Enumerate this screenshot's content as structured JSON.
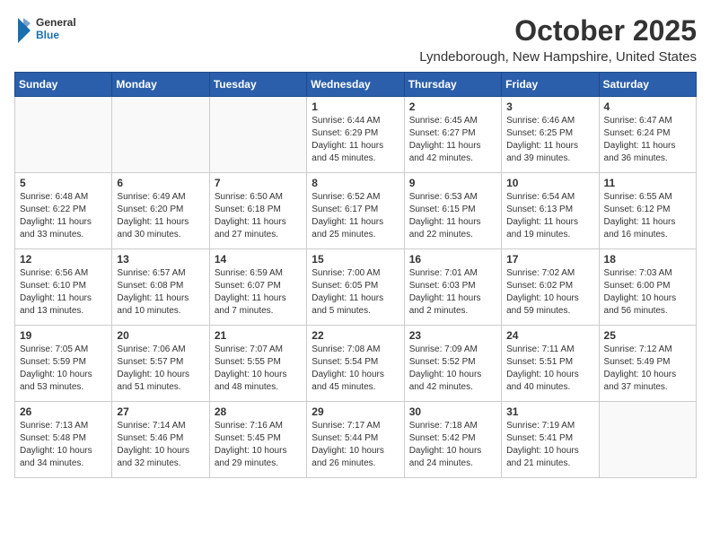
{
  "logo": {
    "general": "General",
    "blue": "Blue"
  },
  "header": {
    "month": "October 2025",
    "location": "Lyndeborough, New Hampshire, United States"
  },
  "weekdays": [
    "Sunday",
    "Monday",
    "Tuesday",
    "Wednesday",
    "Thursday",
    "Friday",
    "Saturday"
  ],
  "weeks": [
    [
      {
        "day": "",
        "info": ""
      },
      {
        "day": "",
        "info": ""
      },
      {
        "day": "",
        "info": ""
      },
      {
        "day": "1",
        "info": "Sunrise: 6:44 AM\nSunset: 6:29 PM\nDaylight: 11 hours\nand 45 minutes."
      },
      {
        "day": "2",
        "info": "Sunrise: 6:45 AM\nSunset: 6:27 PM\nDaylight: 11 hours\nand 42 minutes."
      },
      {
        "day": "3",
        "info": "Sunrise: 6:46 AM\nSunset: 6:25 PM\nDaylight: 11 hours\nand 39 minutes."
      },
      {
        "day": "4",
        "info": "Sunrise: 6:47 AM\nSunset: 6:24 PM\nDaylight: 11 hours\nand 36 minutes."
      }
    ],
    [
      {
        "day": "5",
        "info": "Sunrise: 6:48 AM\nSunset: 6:22 PM\nDaylight: 11 hours\nand 33 minutes."
      },
      {
        "day": "6",
        "info": "Sunrise: 6:49 AM\nSunset: 6:20 PM\nDaylight: 11 hours\nand 30 minutes."
      },
      {
        "day": "7",
        "info": "Sunrise: 6:50 AM\nSunset: 6:18 PM\nDaylight: 11 hours\nand 27 minutes."
      },
      {
        "day": "8",
        "info": "Sunrise: 6:52 AM\nSunset: 6:17 PM\nDaylight: 11 hours\nand 25 minutes."
      },
      {
        "day": "9",
        "info": "Sunrise: 6:53 AM\nSunset: 6:15 PM\nDaylight: 11 hours\nand 22 minutes."
      },
      {
        "day": "10",
        "info": "Sunrise: 6:54 AM\nSunset: 6:13 PM\nDaylight: 11 hours\nand 19 minutes."
      },
      {
        "day": "11",
        "info": "Sunrise: 6:55 AM\nSunset: 6:12 PM\nDaylight: 11 hours\nand 16 minutes."
      }
    ],
    [
      {
        "day": "12",
        "info": "Sunrise: 6:56 AM\nSunset: 6:10 PM\nDaylight: 11 hours\nand 13 minutes."
      },
      {
        "day": "13",
        "info": "Sunrise: 6:57 AM\nSunset: 6:08 PM\nDaylight: 11 hours\nand 10 minutes."
      },
      {
        "day": "14",
        "info": "Sunrise: 6:59 AM\nSunset: 6:07 PM\nDaylight: 11 hours\nand 7 minutes."
      },
      {
        "day": "15",
        "info": "Sunrise: 7:00 AM\nSunset: 6:05 PM\nDaylight: 11 hours\nand 5 minutes."
      },
      {
        "day": "16",
        "info": "Sunrise: 7:01 AM\nSunset: 6:03 PM\nDaylight: 11 hours\nand 2 minutes."
      },
      {
        "day": "17",
        "info": "Sunrise: 7:02 AM\nSunset: 6:02 PM\nDaylight: 10 hours\nand 59 minutes."
      },
      {
        "day": "18",
        "info": "Sunrise: 7:03 AM\nSunset: 6:00 PM\nDaylight: 10 hours\nand 56 minutes."
      }
    ],
    [
      {
        "day": "19",
        "info": "Sunrise: 7:05 AM\nSunset: 5:59 PM\nDaylight: 10 hours\nand 53 minutes."
      },
      {
        "day": "20",
        "info": "Sunrise: 7:06 AM\nSunset: 5:57 PM\nDaylight: 10 hours\nand 51 minutes."
      },
      {
        "day": "21",
        "info": "Sunrise: 7:07 AM\nSunset: 5:55 PM\nDaylight: 10 hours\nand 48 minutes."
      },
      {
        "day": "22",
        "info": "Sunrise: 7:08 AM\nSunset: 5:54 PM\nDaylight: 10 hours\nand 45 minutes."
      },
      {
        "day": "23",
        "info": "Sunrise: 7:09 AM\nSunset: 5:52 PM\nDaylight: 10 hours\nand 42 minutes."
      },
      {
        "day": "24",
        "info": "Sunrise: 7:11 AM\nSunset: 5:51 PM\nDaylight: 10 hours\nand 40 minutes."
      },
      {
        "day": "25",
        "info": "Sunrise: 7:12 AM\nSunset: 5:49 PM\nDaylight: 10 hours\nand 37 minutes."
      }
    ],
    [
      {
        "day": "26",
        "info": "Sunrise: 7:13 AM\nSunset: 5:48 PM\nDaylight: 10 hours\nand 34 minutes."
      },
      {
        "day": "27",
        "info": "Sunrise: 7:14 AM\nSunset: 5:46 PM\nDaylight: 10 hours\nand 32 minutes."
      },
      {
        "day": "28",
        "info": "Sunrise: 7:16 AM\nSunset: 5:45 PM\nDaylight: 10 hours\nand 29 minutes."
      },
      {
        "day": "29",
        "info": "Sunrise: 7:17 AM\nSunset: 5:44 PM\nDaylight: 10 hours\nand 26 minutes."
      },
      {
        "day": "30",
        "info": "Sunrise: 7:18 AM\nSunset: 5:42 PM\nDaylight: 10 hours\nand 24 minutes."
      },
      {
        "day": "31",
        "info": "Sunrise: 7:19 AM\nSunset: 5:41 PM\nDaylight: 10 hours\nand 21 minutes."
      },
      {
        "day": "",
        "info": ""
      }
    ]
  ]
}
